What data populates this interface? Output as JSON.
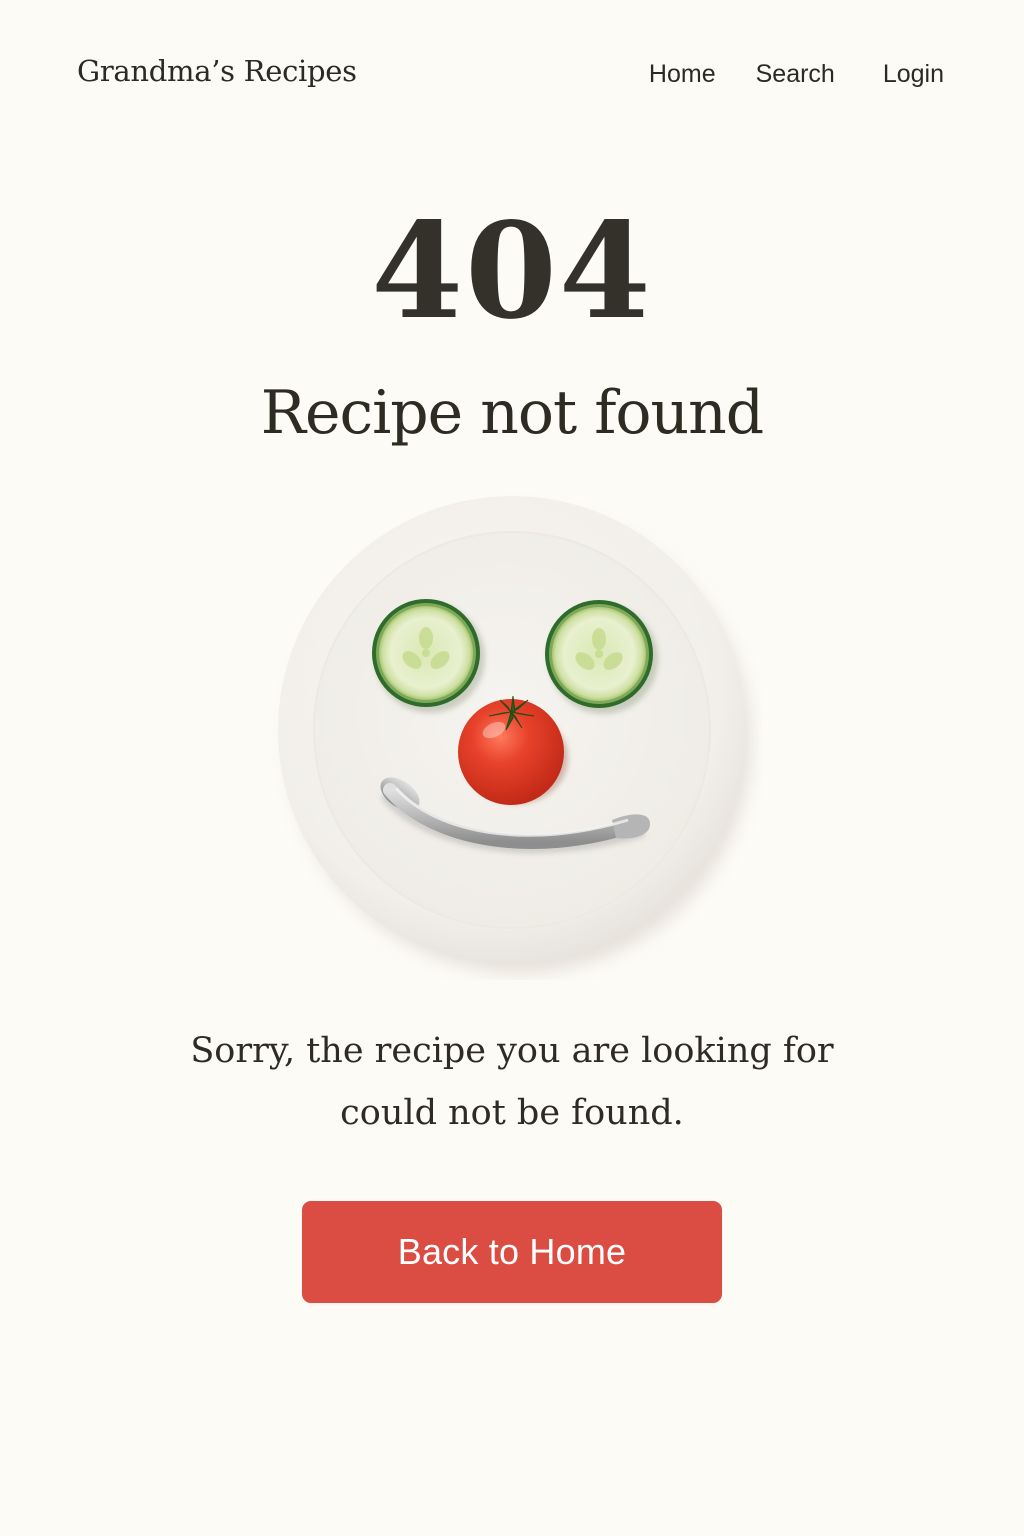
{
  "header": {
    "brand": "Grandma’s Recipes",
    "nav": [
      {
        "label": "Home"
      },
      {
        "label": "Search"
      },
      {
        "label": "Login"
      }
    ]
  },
  "error": {
    "code": "404",
    "title": "Recipe not found",
    "message_line1": "Sorry, the recipe you are looking for",
    "message_line2": "could not be found.",
    "button_label": "Back to Home"
  },
  "illustration": {
    "subject": "plate-smiley-face",
    "items": [
      "cucumber-slice-icon",
      "cucumber-slice-icon",
      "cherry-tomato-icon",
      "spoon-smile-icon"
    ]
  },
  "colors": {
    "background": "#fdfbf6",
    "text": "#2e2b22",
    "button": "#db4c42",
    "button_text": "#ffffff",
    "plate": "#f4f1ec",
    "cucumber_skin": "#2f6b2a",
    "cucumber_flesh": "#e2ecc2",
    "tomato": "#e33b26"
  }
}
